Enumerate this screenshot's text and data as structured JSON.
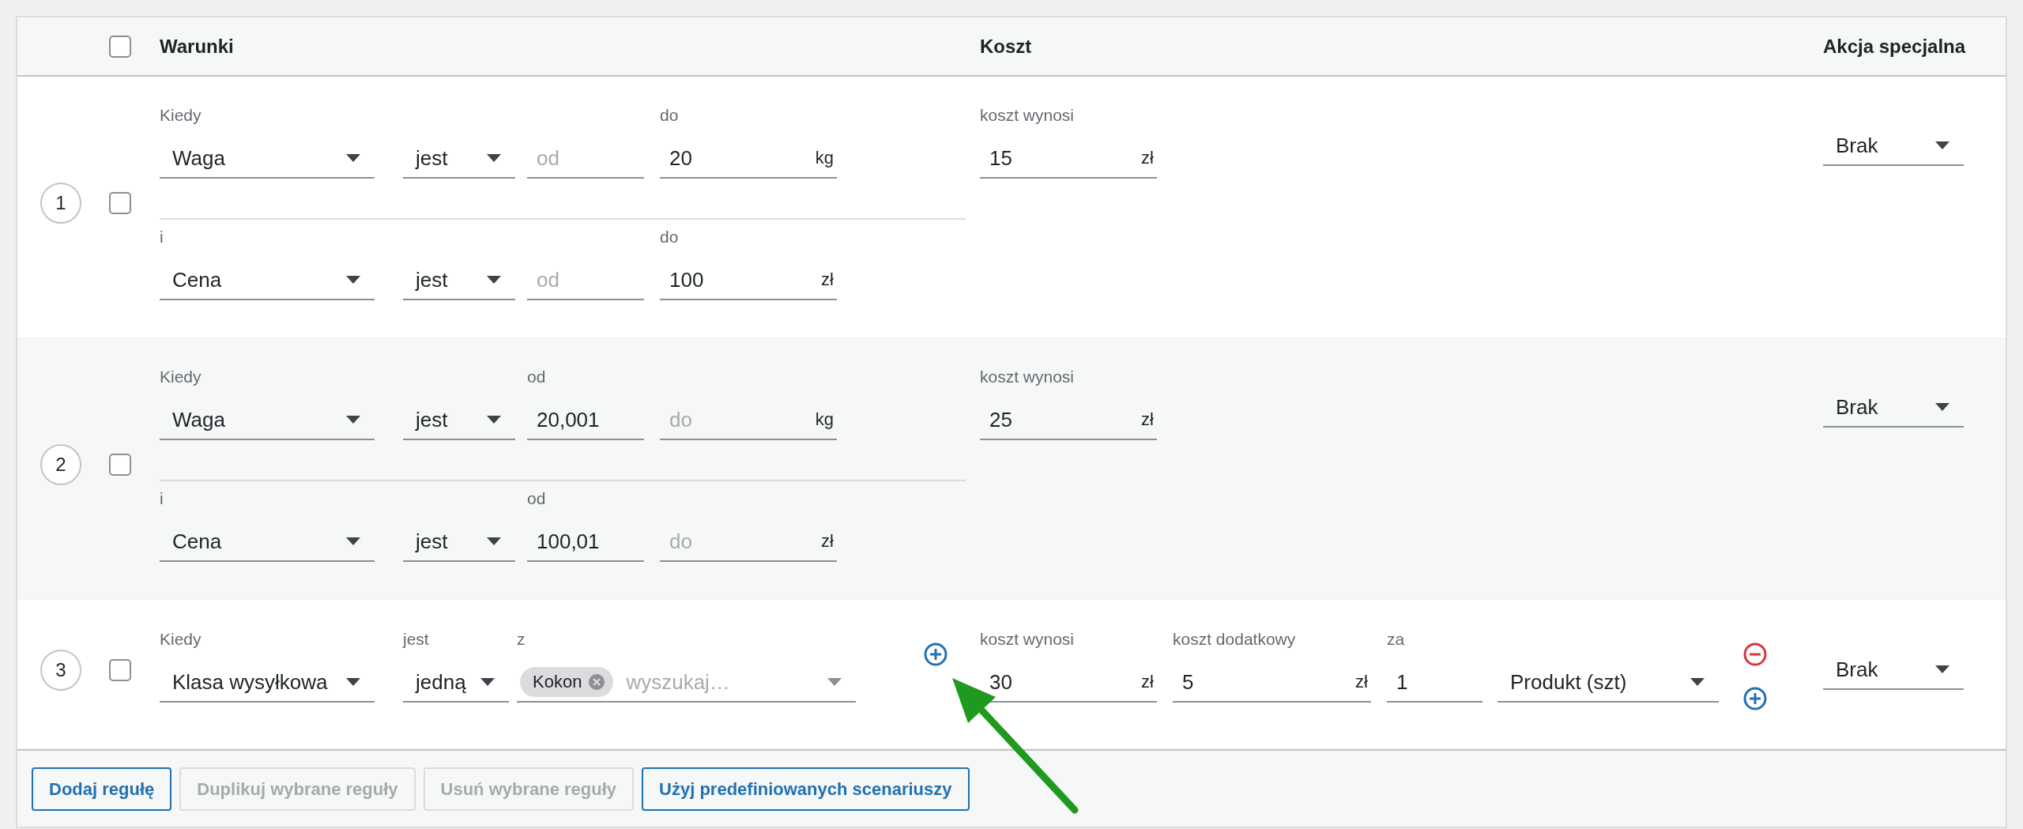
{
  "table": {
    "select_all": {
      "checked": false
    },
    "columns": [
      "Warunki",
      "Koszt",
      "Akcja specjalna"
    ]
  },
  "rules": [
    {
      "number": "1",
      "checked": false,
      "conditions": [
        {
          "kind": "range",
          "label": "Kiedy",
          "field": "Waga",
          "operator": "jest",
          "from": {
            "placeholder": "od"
          },
          "to": {
            "label": "do",
            "value": "20"
          },
          "unit": "kg"
        },
        {
          "kind": "range",
          "label": "i",
          "field": "Cena",
          "operator": "jest",
          "from": {
            "placeholder": "od"
          },
          "to": {
            "label": "do",
            "value": "100"
          },
          "unit": "zł"
        }
      ],
      "add_condition_button": false,
      "costs": [
        {
          "kind": "amount",
          "label": "koszt wynosi",
          "value": "15",
          "unit": "zł"
        }
      ],
      "cost_row_buttons": false,
      "special_action": "Brak"
    },
    {
      "number": "2",
      "checked": false,
      "conditions": [
        {
          "kind": "range",
          "label": "Kiedy",
          "field": "Waga",
          "operator": "jest",
          "from": {
            "label": "od",
            "value": "20,001"
          },
          "to": {
            "placeholder": "do"
          },
          "unit": "kg"
        },
        {
          "kind": "range",
          "label": "i",
          "field": "Cena",
          "operator": "jest",
          "from": {
            "label": "od",
            "value": "100,01"
          },
          "to": {
            "placeholder": "do"
          },
          "unit": "zł"
        }
      ],
      "add_condition_button": false,
      "costs": [
        {
          "kind": "amount",
          "label": "koszt wynosi",
          "value": "25",
          "unit": "zł"
        }
      ],
      "cost_row_buttons": false,
      "special_action": "Brak"
    },
    {
      "number": "3",
      "checked": false,
      "conditions": [
        {
          "kind": "class",
          "label": "Kiedy",
          "field": "Klasa wysyłkowa",
          "operator_label": "jest",
          "operator": "jedną",
          "values_label": "z",
          "tags": [
            "Kokon"
          ],
          "search_placeholder": "wyszukaj…"
        }
      ],
      "add_condition_button": true,
      "costs": [
        {
          "kind": "amount",
          "label": "koszt wynosi",
          "value": "30",
          "unit": "zł"
        },
        {
          "kind": "amount",
          "label": "koszt dodatkowy",
          "value": "5",
          "unit": "zł"
        },
        {
          "kind": "quantity",
          "label": "za",
          "value": "1"
        },
        {
          "kind": "unit_select",
          "value": "Produkt (szt)"
        }
      ],
      "cost_row_buttons": true,
      "special_action": "Brak"
    }
  ],
  "buttons": [
    {
      "label": "Dodaj regułę",
      "disabled": false
    },
    {
      "label": "Duplikuj wybrane reguły",
      "disabled": true
    },
    {
      "label": "Usuń wybrane reguły",
      "disabled": true
    },
    {
      "label": "Użyj predefiniowanych scenariuszy",
      "disabled": false
    }
  ]
}
